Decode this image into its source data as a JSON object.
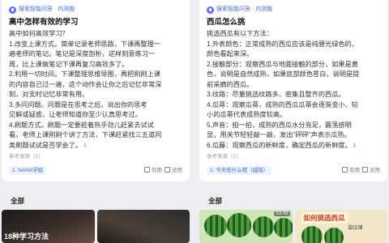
{
  "left_card": {
    "badge": "搜索智能问答 · 内测版",
    "title": "高中怎样有效的学习",
    "lines": [
      "高中如何高效学习？",
      "1.改变上课方式。简单记录老师思路，下课再整理一",
      "遍老师的笔记。笔记是深度剖析，这样刻意练习一",
      "周，比上课做笔记下课再复习高效多了。",
      "2.利用一切时间。下课整理思维导图，再把刚刚上课",
      "的内容自己过一遍，这个动作会让你之后记忆非常深",
      "刻，对支时记忆非常有用。",
      "3.多问问题。问题是在思考之后，说出你的思考",
      "见解或疑惑，让老师知道你至少认真思考过。",
      "4.刷题方式。刷题一定要趁着热乎劲儿赶紧去试试",
      "看。老师上课刚刚个讲了方法，下课赶紧找三五道同",
      "类刷题试试是否学会了。"
    ],
    "footnote": "1",
    "ref_label": "参考来源（1）",
    "ref_link": "1. NANA学姐",
    "like": "有用",
    "dislike": "没用"
  },
  "right_card": {
    "badge": "搜索智能问答 · 内测版",
    "title": "西瓜怎么挑",
    "lines": [
      "挑选西瓜有以下方法：",
      "1.外表颜色：正常成熟的西瓜应该是纯碧光绿色的，",
      "颜色看起来深。",
      "2.接触部分：观察西瓜与地面接触的部分，如果是黄",
      "色，说明是自然成熟，如果底部颜色苍白，说明是提",
      "前采摘的西瓜。",
      "3.纹路：尽量挑选纹路多、密集且整齐的西瓜。",
      "4.瓜蒂：观察瓜蒂，成熟的西瓜瓜蒂会逐渐变小、较",
      "小的瓜蒂代表成熟度较高。",
      "5.声音：拍一拍，成熟的西瓜水分充足，震荡感明",
      "显，用关节轻轻敲一敲，发出\"砰砰\"声表示瓜熟。",
      "6.瓜藤：观察西瓜的新鲜度，确定西瓜的新鲜度。"
    ],
    "footnote": "1",
    "ref_label": "参考来源（1）",
    "ref_link": "1. 今天吃什么呢（威瑶）",
    "like": "有用",
    "dislike": "没用"
  },
  "left_section": {
    "label": "全部",
    "thumb_caption": "18种学习方法"
  },
  "right_section": {
    "label": "全部",
    "duration": "03:49",
    "poster_title": "如何挑选西瓜",
    "poster_tag": "甜瓜铺"
  }
}
